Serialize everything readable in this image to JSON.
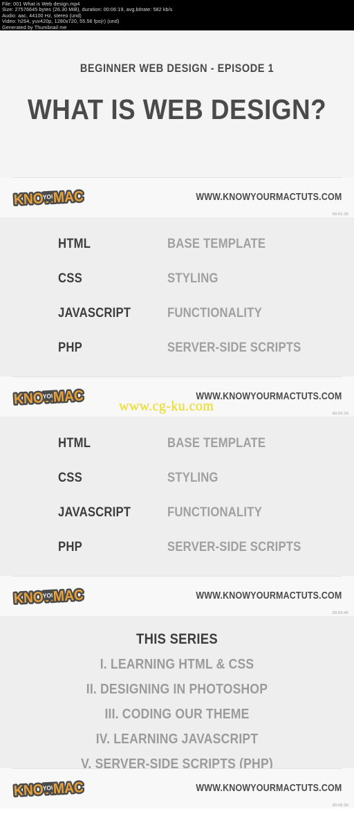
{
  "meta_header": {
    "lines": [
      "File: 001 What is Web design.mp4",
      "Size: 27576645 bytes (26.30 MiB), duration: 00:06:19, avg.bitrate: 582 kb/s",
      "Audio: aac, 44100 Hz, stereo (und)",
      "Video: h264, yuv420p, 1280x720, 55.56 fps(r) (und)",
      "Generated by Thumbnail me"
    ]
  },
  "title_slide": {
    "eyebrow": "BEGINNER WEB DESIGN - EPISODE 1",
    "headline": "WHAT IS WEB DESIGN?"
  },
  "brand": {
    "logo_know": "KNOW",
    "logo_your": "YOUR",
    "logo_mac": "MAC",
    "url": "WWW.KNOWYOURMACTUTS.COM",
    "logo_orange": "#e8a13a",
    "logo_outline": "#4a4a4a"
  },
  "timecodes": {
    "frame1": "00:01:36",
    "frame2": "00:03:16",
    "frame3": "00:03:46",
    "frame4": "00:05:30"
  },
  "tech_list": {
    "rows": [
      {
        "term": "HTML",
        "desc": "BASE TEMPLATE"
      },
      {
        "term": "CSS",
        "desc": "STYLING"
      },
      {
        "term": "JAVASCRIPT",
        "desc": "FUNCTIONALITY"
      },
      {
        "term": "PHP",
        "desc": "SERVER-SIDE SCRIPTS"
      }
    ]
  },
  "series_slide": {
    "title": "THIS SERIES",
    "items": [
      "I. LEARNING HTML & CSS",
      "II. DESIGNING IN PHOTOSHOP",
      "III. CODING OUR THEME",
      "IV. LEARNING JAVASCRIPT",
      "V. SERVER-SIDE SCRIPTS (PHP)"
    ]
  },
  "watermark": {
    "text": "www.cg-ku.com",
    "color": "#f2e31f"
  }
}
